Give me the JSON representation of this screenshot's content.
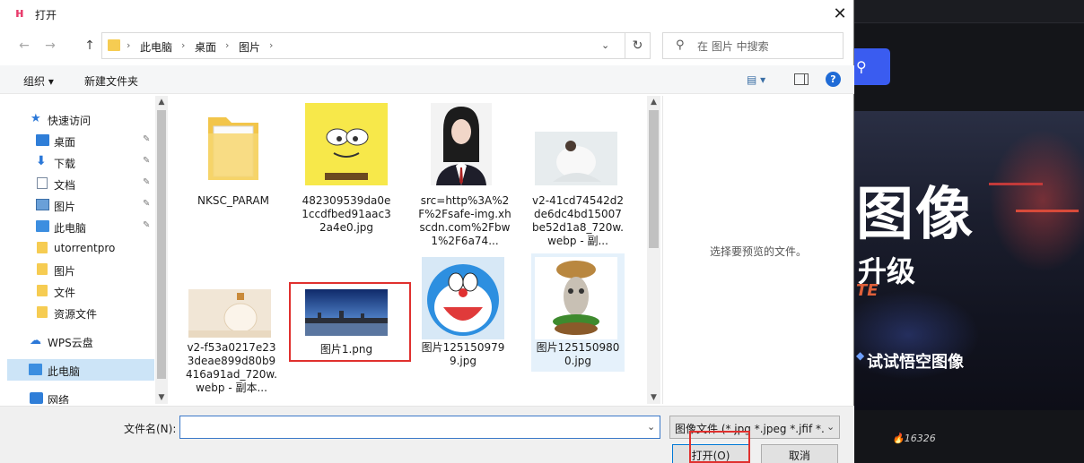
{
  "dialog": {
    "title": "打开",
    "close_glyph": "✕"
  },
  "navigation": {
    "back_glyph": "←",
    "forward_glyph": "→",
    "up_glyph": "↑",
    "breadcrumbs": [
      "此电脑",
      "桌面",
      "图片"
    ],
    "separator": "›",
    "dropdown_glyph": "⌄",
    "refresh_glyph": "↻",
    "search_icon": "⚲",
    "search_placeholder": "在 图片 中搜索"
  },
  "toolbar": {
    "organize_label": "组织 ▾",
    "new_folder_label": "新建文件夹",
    "view_label": "▤ ▾",
    "help_glyph": "?"
  },
  "sidebar": {
    "items": [
      {
        "label": "快速访问",
        "icon": "star-icon",
        "glyph": "★",
        "pinned": false,
        "selected": false
      },
      {
        "label": "桌面",
        "icon": "desktop-icon",
        "glyph": "",
        "pinned": true,
        "selected": false
      },
      {
        "label": "下载",
        "icon": "download-icon",
        "glyph": "⬇",
        "pinned": true,
        "selected": false
      },
      {
        "label": "文档",
        "icon": "document-icon",
        "glyph": "",
        "pinned": true,
        "selected": false
      },
      {
        "label": "图片",
        "icon": "pictures-icon",
        "glyph": "",
        "pinned": true,
        "selected": false
      },
      {
        "label": "此电脑",
        "icon": "computer-icon",
        "glyph": "",
        "pinned": true,
        "selected": false
      },
      {
        "label": "utorrentpro",
        "icon": "folder-icon",
        "glyph": "",
        "pinned": false,
        "selected": false
      },
      {
        "label": "图片",
        "icon": "folder-icon",
        "glyph": "",
        "pinned": false,
        "selected": false
      },
      {
        "label": "文件",
        "icon": "folder-icon",
        "glyph": "",
        "pinned": false,
        "selected": false
      },
      {
        "label": "资源文件",
        "icon": "folder-icon",
        "glyph": "",
        "pinned": false,
        "selected": false
      },
      {
        "label": "WPS云盘",
        "icon": "cloud-icon",
        "glyph": "☁",
        "pinned": false,
        "selected": false
      },
      {
        "label": "此电脑",
        "icon": "computer-icon",
        "glyph": "",
        "pinned": false,
        "selected": true
      },
      {
        "label": "网络",
        "icon": "network-icon",
        "glyph": "",
        "pinned": false,
        "selected": false
      }
    ],
    "pin_glyph": "✎"
  },
  "files": [
    {
      "name": "NKSC_PARAM",
      "kind": "folder"
    },
    {
      "name": "482309539da0e1ccdfbed91aac32a4e0.jpg",
      "kind": "sponge"
    },
    {
      "name": "src=http%3A%2F%2Fsafe-img.xhscdn.com%2Fbw1%2F6a74...",
      "kind": "portrait"
    },
    {
      "name": "v2-41cd74542d2de6dc4bd15007be52d1a8_720w.webp - 副...",
      "kind": "photo-light"
    },
    {
      "name": "v2-f53a0217e233deae899d80b9416a91ad_720w.webp - 副本...",
      "kind": "bottle"
    },
    {
      "name": "图片1.png",
      "kind": "city"
    },
    {
      "name": "图片1251509799.jpg",
      "kind": "doraemon"
    },
    {
      "name": "图片1251509800.jpg",
      "kind": "burger"
    }
  ],
  "preview": {
    "empty_text": "选择要预览的文件。"
  },
  "bottom": {
    "filename_label": "文件名(N):",
    "filename_value": "",
    "filetype_value": "图像文件 (*.jpg *.jpeg *.jfif *.b",
    "open_label": "打开(O)",
    "cancel_label": "取消"
  },
  "background_app": {
    "headline": "图像",
    "subline": "升级",
    "accent": "TE",
    "cta": "试试悟空图像",
    "counter": "🔥16326"
  },
  "colors": {
    "accent": "#0078d7",
    "highlight": "#e0302e",
    "selection": "#cce4f7"
  }
}
